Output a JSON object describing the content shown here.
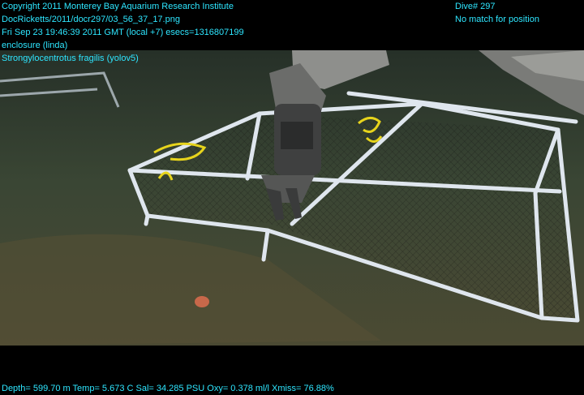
{
  "header": {
    "copyright": "Copyright 2011 Monterey Bay Aquarium Research Institute",
    "image_path": "DocRicketts/2011/docr297/03_56_37_17.png",
    "timestamp": "Fri Sep 23 19:46:39 2011 GMT (local +7)  esecs=1316807199",
    "annotation_1": "enclosure (linda)",
    "annotation_2": "Strongylocentrotus fragilis (yolov5)",
    "dive_label": "Dive# 297",
    "position_status": "No match for position"
  },
  "footer": {
    "telemetry": "Depth= 599.70 m  Temp= 5.673 C  Sal= 34.285 PSU  Oxy= 0.378 ml/l  Xmiss= 76.88%"
  },
  "colors": {
    "overlay_text": "#2ee6ff",
    "seafloor": "#3e4a37",
    "pipe": "#dfe6ee"
  }
}
